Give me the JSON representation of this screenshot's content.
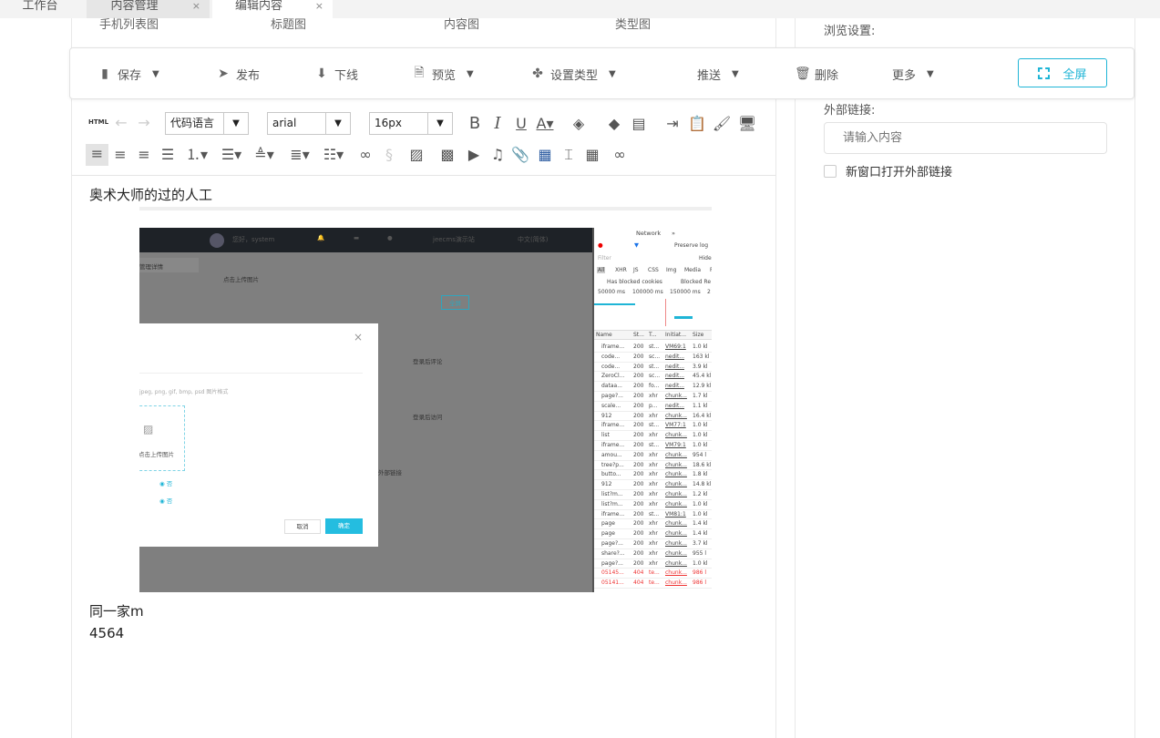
{
  "tabs": [
    {
      "label": "工作台"
    },
    {
      "label": "内容管理",
      "close": "×"
    },
    {
      "label": "编辑内容",
      "close": "×"
    }
  ],
  "image_columns": [
    "手机列表图",
    "标题图",
    "内容图",
    "类型图"
  ],
  "toolbar": {
    "save": "保存",
    "publish": "发布",
    "offline": "下线",
    "preview": "预览",
    "set_type": "设置类型",
    "push": "推送",
    "delete": "删除",
    "more": "更多",
    "fullscreen": "全屏"
  },
  "editor": {
    "html_label": "HTML",
    "code_language": "代码语言",
    "font_family": "arial",
    "font_size": "16px",
    "content_line1": "奥术大师的过的人工",
    "content_line2": "同一家m",
    "content_line3": "4564"
  },
  "side": {
    "browse_settings": "浏览设置:",
    "external_link_label": "外部链接:",
    "external_link_placeholder": "请输入内容",
    "new_window_label": "新窗口打开外部链接",
    "new_window_checked": false
  },
  "accent_color": "#1fb5d6",
  "embedded_screenshot": {
    "header": {
      "greeting": "您好，system",
      "site": "jeecms演示站",
      "language": "中文(简体)"
    },
    "tab": "管理详情",
    "upload_col": "点击上传图片",
    "fullscreen": "全屏",
    "login_comment": "登录后评论",
    "login_visit": "登录后访问",
    "external_link": "外部链接",
    "dialog": {
      "close": "×",
      "formats": "jpeg, png, gif, bmp, psd 图片格式",
      "upload": "点击上传图片",
      "opt1": "否",
      "opt2": "否",
      "cancel": "取消",
      "ok": "确定"
    },
    "devtools": {
      "tab": "Network",
      "more": "»",
      "preserve_log": "Preserve log",
      "filter": "Filter",
      "hide": "Hide",
      "types": [
        "All",
        "XHR",
        "JS",
        "CSS",
        "Img",
        "Media",
        "Font"
      ],
      "blocked_cookies": "Has blocked cookies",
      "blocked_req": "Blocked Re",
      "timeline": [
        "50000 ms",
        "100000 ms",
        "150000 ms",
        "2"
      ],
      "columns": [
        "Name",
        "St...",
        "T...",
        "Initiat...",
        "Size"
      ],
      "rows": [
        [
          "iframe...",
          "200",
          "st...",
          "VM69:1",
          "1.0 kl"
        ],
        [
          "code...",
          "200",
          "sc...",
          "nedit...",
          "163 kl"
        ],
        [
          "code...",
          "200",
          "st...",
          "nedit...",
          "3.9 kl"
        ],
        [
          "ZeroCl...",
          "200",
          "sc...",
          "nedit...",
          "45.4 kl"
        ],
        [
          "dataa...",
          "200",
          "fo...",
          "nedit...",
          "12.9 kl"
        ],
        [
          "page?...",
          "200",
          "xhr",
          "chunk...",
          "1.7 kl"
        ],
        [
          "scale...",
          "200",
          "p...",
          "nedit...",
          "1.1 kl"
        ],
        [
          "912",
          "200",
          "xhr",
          "chunk...",
          "16.4 kl"
        ],
        [
          "iframe...",
          "200",
          "st...",
          "VM77:1",
          "1.0 kl"
        ],
        [
          "list",
          "200",
          "xhr",
          "chunk...",
          "1.0 kl"
        ],
        [
          "iframe...",
          "200",
          "st...",
          "VM79:1",
          "1.0 kl"
        ],
        [
          "amou...",
          "200",
          "xhr",
          "chunk...",
          "954 l"
        ],
        [
          "tree?p...",
          "200",
          "xhr",
          "chunk...",
          "18.6 kl"
        ],
        [
          "butto...",
          "200",
          "xhr",
          "chunk...",
          "1.8 kl"
        ],
        [
          "912",
          "200",
          "xhr",
          "chunk...",
          "14.8 kl"
        ],
        [
          "list?m...",
          "200",
          "xhr",
          "chunk...",
          "1.2 kl"
        ],
        [
          "list?m...",
          "200",
          "xhr",
          "chunk...",
          "1.0 kl"
        ],
        [
          "iframe...",
          "200",
          "st...",
          "VM81:1",
          "1.0 kl"
        ],
        [
          "page",
          "200",
          "xhr",
          "chunk...",
          "1.4 kl"
        ],
        [
          "page",
          "200",
          "xhr",
          "chunk...",
          "1.4 kl"
        ],
        [
          "page?...",
          "200",
          "xhr",
          "chunk...",
          "3.7 kl"
        ],
        [
          "share?...",
          "200",
          "xhr",
          "chunk...",
          "955 l"
        ],
        [
          "page?...",
          "200",
          "xhr",
          "chunk...",
          "1.0 kl"
        ],
        [
          "05145...",
          "404",
          "te...",
          "chunk...",
          "986 l"
        ],
        [
          "05141...",
          "404",
          "te...",
          "chunk...",
          "986 l"
        ]
      ]
    }
  }
}
